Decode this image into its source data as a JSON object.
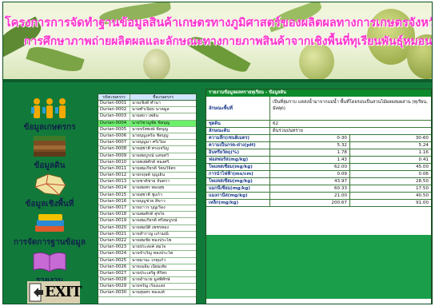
{
  "banner": {
    "line1": "โครงการการจัดทำฐานข้อมูลสินค้าเกษตรทางภูมิศาสตร์ของผลิตผลทางการเกษตรจังหวัดสุราษฎร์ธานี",
    "line2": "การศึกษาภาพถ่ายผลิตผลและลักษณะทางกายภาพสินค้าจากเชิงพื้นที่ทุเรียนพันธุ์หมอนทองสะหลักสะหลัก"
  },
  "sidebar": {
    "items": [
      {
        "label": "ข้อมูลเกษตรกร",
        "icon": "farmers-icon"
      },
      {
        "label": "ข้อมูลดิน",
        "icon": "soil-icon"
      },
      {
        "label": "ข้อมูลเชิงพื้นที่",
        "icon": "map-icon"
      },
      {
        "label": "การจัดการฐานข้อมูล",
        "icon": "database-icon"
      },
      {
        "label": "รายงาน",
        "icon": "book-icon"
      },
      {
        "label": "EXIT",
        "icon": "exit-icon"
      }
    ]
  },
  "list": {
    "header_code": "รหัสเกษตรกร",
    "header_name": "ชื่อเกษตรกร",
    "selected_index": 3,
    "rows": [
      {
        "code": "Durian-0001",
        "name": "นายเชิงดี ทำนา"
      },
      {
        "code": "Durian-0002",
        "name": "นายทำเนียบ นาคมูล"
      },
      {
        "code": "Durian-0003",
        "name": "นายสถา เพลิน"
      },
      {
        "code": "Durian-0004",
        "name": "นายวิชาญชัย ชิดบุญ"
      },
      {
        "code": "Durian-0005",
        "name": "นายจรัสพงษ์ ชิดบุญ"
      },
      {
        "code": "Durian-0006",
        "name": "นายบุญเครือ ชิดบุญ"
      },
      {
        "code": "Durian-0007",
        "name": "นายบุญมา ศรีเวียง"
      },
      {
        "code": "Durian-0008",
        "name": "นายสุชาติ ทรงเจริญ"
      },
      {
        "code": "Durian-0009",
        "name": "นายสมบูรณ์ แสนทวี"
      },
      {
        "code": "Durian-0010",
        "name": "นายพงษ์ศักดิ์ ทองศรี"
      },
      {
        "code": "Durian-0011",
        "name": "นายสมเกียรติ รัตนวิจิตร"
      },
      {
        "code": "Durian-0012",
        "name": "นายกฤษดิ์ บุญเย็น"
      },
      {
        "code": "Durian-0013",
        "name": "นายชาติชาย จันทรา"
      },
      {
        "code": "Durian-0014",
        "name": "นายสมพร ทองสุข"
      },
      {
        "code": "Durian-0015",
        "name": "นายสุชาติ ชูแก้ว"
      },
      {
        "code": "Durian-0016",
        "name": "นายบุญช่วย สีขาว"
      },
      {
        "code": "Durian-0017",
        "name": "นายถาวร บุญเรือง"
      },
      {
        "code": "Durian-0018",
        "name": "นายสมศักดิ์ สุขใจ"
      },
      {
        "code": "Durian-0019",
        "name": "นายสมเกียรติ ศรีสมบูรณ์"
      },
      {
        "code": "Durian-0020",
        "name": "นายสมบัติ เพชรทอง"
      },
      {
        "code": "Durian-0021",
        "name": "นายสำราญ แก้วมณี"
      },
      {
        "code": "Durian-0022",
        "name": "นายสมชัย ทองประไพ"
      },
      {
        "code": "Durian-0023",
        "name": "นายประสงค์ สมใจ"
      },
      {
        "code": "Durian-0024",
        "name": "นายจำเริญ ทองประไพ"
      },
      {
        "code": "Durian-0025",
        "name": "นายมานะ เกตุแก้ว"
      },
      {
        "code": "Durian-0026",
        "name": "นายเฉลิม เนียมเพ็ง"
      },
      {
        "code": "Durian-0027",
        "name": "นายประเสริฐ ศิริพร"
      },
      {
        "code": "Durian-0028",
        "name": "นายอำนวย มูลพิทักษ์"
      },
      {
        "code": "Durian-0029",
        "name": "นายจรัญ เรืองแสง"
      },
      {
        "code": "Durian-0030",
        "name": "นายสุนทร ทองแท้"
      }
    ]
  },
  "detail": {
    "title": "รายงานข้อมูลผลทรายทุเรียน - ข้อมูลดิน",
    "rows": [
      {
        "label": "ลักษณะพื้นที่",
        "value": "เป็นที่ลุ่มราบ แหล่งน้ำมาจากแม่น้ำ พื้นที่โดยรอบเป็นสวนไม้ผลผสมผสาน (ทุเรียน, มังคุด)"
      },
      {
        "label": "ชุดดิน",
        "value": "62"
      },
      {
        "label": "ลักษณะดิน",
        "value": "ดินร่วนปนทราย"
      }
    ],
    "measurements": [
      {
        "label": "ความลึก(เซนติเมตร)",
        "v1": "0-30",
        "v2": "30-60"
      },
      {
        "label": "ความเป็นกรด-ด่าง(pH)",
        "v1": "5.32",
        "v2": "5.24"
      },
      {
        "label": "อินทรียวัตถุ(%)",
        "v1": "1.78",
        "v2": "1.16"
      },
      {
        "label": "ฟอสฟอรัส(mg/kg)",
        "v1": "1.43",
        "v2": "0.41"
      },
      {
        "label": "โพแทสเซียม(mg/kg)",
        "v1": "62.00",
        "v2": "45.00"
      },
      {
        "label": "การนำไฟฟ้า(ms/cm)",
        "v1": "0.09",
        "v2": "0.06"
      },
      {
        "label": "โพแทสเซียม(mg/kg)",
        "v1": "43.97",
        "v2": "28.50"
      },
      {
        "label": "แมกนีเซียม(mg/kg)",
        "v1": "60.33",
        "v2": "17.50"
      },
      {
        "label": "แมงกานีส(mg/kg)",
        "v1": "21.00",
        "v2": "40.50"
      },
      {
        "label": "เหล็ก(mg/kg)",
        "v1": "200.67",
        "v2": "91.00"
      }
    ]
  },
  "colors": {
    "window_green": "#117a3a",
    "banner_text": "#ff33cc",
    "selected_row": "#6cf06c"
  }
}
